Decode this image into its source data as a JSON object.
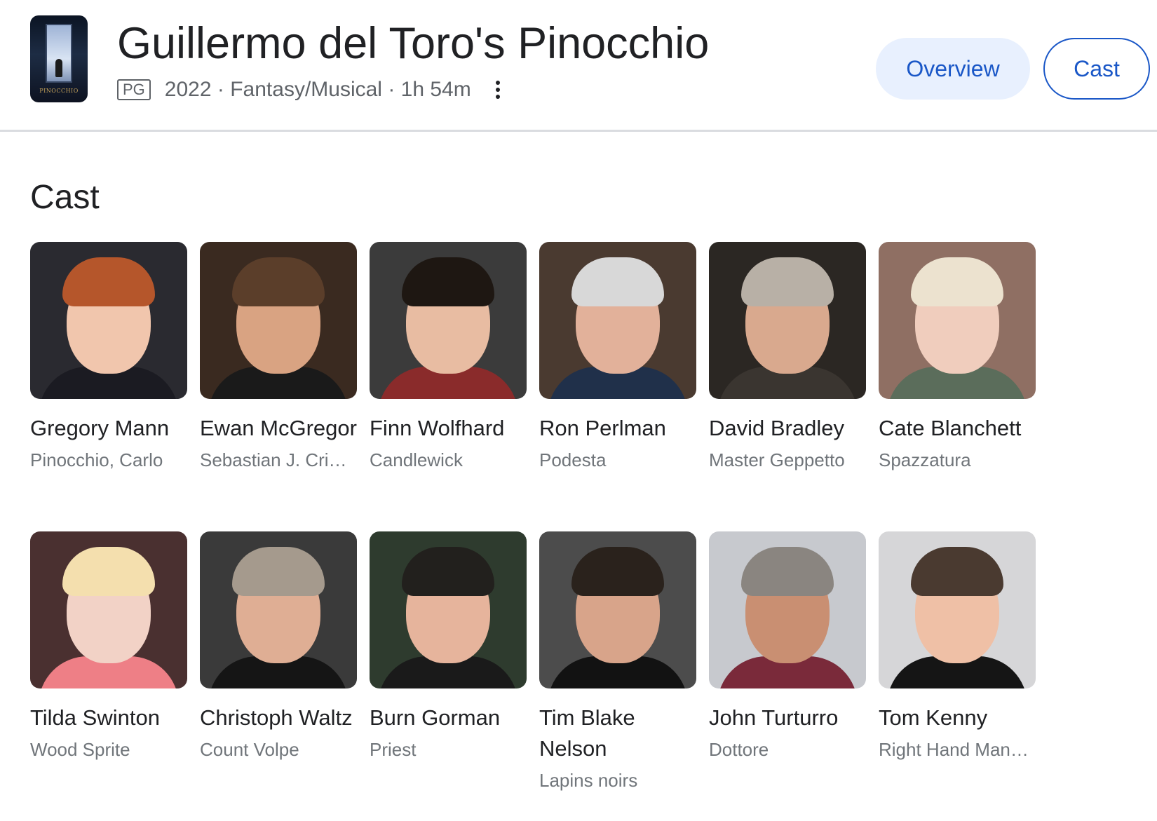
{
  "header": {
    "title": "Guillermo del Toro's Pinocchio",
    "poster_text": "PINOCCHIO",
    "rating": "PG",
    "year": "2022",
    "separator": "·",
    "genre": "Fantasy/Musical",
    "runtime": "1h 54m",
    "tabs": [
      {
        "label": "Overview",
        "selected": false
      },
      {
        "label": "Cast",
        "selected": true
      }
    ]
  },
  "section_title": "Cast",
  "cast": [
    {
      "name": "Gregory Mann",
      "role": "Pinocchio, Carlo",
      "bg": "#2a2a30",
      "skin": "#f1c6ad",
      "hair": "#b5562b",
      "cloth": "#1b1b22"
    },
    {
      "name": "Ewan McGregor",
      "role": "Sebastian J. Cri…",
      "bg": "#3a2a20",
      "skin": "#d9a382",
      "hair": "#5b3e2a",
      "cloth": "#1a1a1a"
    },
    {
      "name": "Finn Wolfhard",
      "role": "Candlewick",
      "bg": "#3b3b3b",
      "skin": "#e8bca2",
      "hair": "#1e1712",
      "cloth": "#8a2b2b"
    },
    {
      "name": "Ron Perlman",
      "role": "Podesta",
      "bg": "#4a3a30",
      "skin": "#e2b19a",
      "hair": "#d8d8d8",
      "cloth": "#20304a"
    },
    {
      "name": "David Bradley",
      "role": "Master Geppetto",
      "bg": "#2b2723",
      "skin": "#d9a98e",
      "hair": "#b8b0a6",
      "cloth": "#3a3530"
    },
    {
      "name": "Cate Blanchett",
      "role": "Spazzatura",
      "bg": "#8f6f63",
      "skin": "#f0cdbd",
      "hair": "#ece2cf",
      "cloth": "#5b6d5b"
    },
    {
      "name": "Tilda Swinton",
      "role": "Wood Sprite",
      "bg": "#4a3030",
      "skin": "#f2d2c6",
      "hair": "#f4dfae",
      "cloth": "#ee7f86"
    },
    {
      "name": "Christoph Waltz",
      "role": "Count Volpe",
      "bg": "#3a3a3a",
      "skin": "#dfae94",
      "hair": "#a59a8d",
      "cloth": "#151515"
    },
    {
      "name": "Burn Gorman",
      "role": "Priest",
      "bg": "#2e3b2e",
      "skin": "#e6b49c",
      "hair": "#22201d",
      "cloth": "#1a1a1a"
    },
    {
      "name": "Tim Blake Nelson",
      "role": "Lapins noirs",
      "bg": "#4c4c4c",
      "skin": "#d8a48a",
      "hair": "#2a221c",
      "cloth": "#121212"
    },
    {
      "name": "John Turturro",
      "role": "Dottore",
      "bg": "#c7c9ce",
      "skin": "#c98f72",
      "hair": "#8a8580",
      "cloth": "#7a2a3a"
    },
    {
      "name": "Tom Kenny",
      "role": "Right Hand Man…",
      "bg": "#d6d6d8",
      "skin": "#efc0a6",
      "hair": "#4a3a30",
      "cloth": "#151515"
    }
  ]
}
